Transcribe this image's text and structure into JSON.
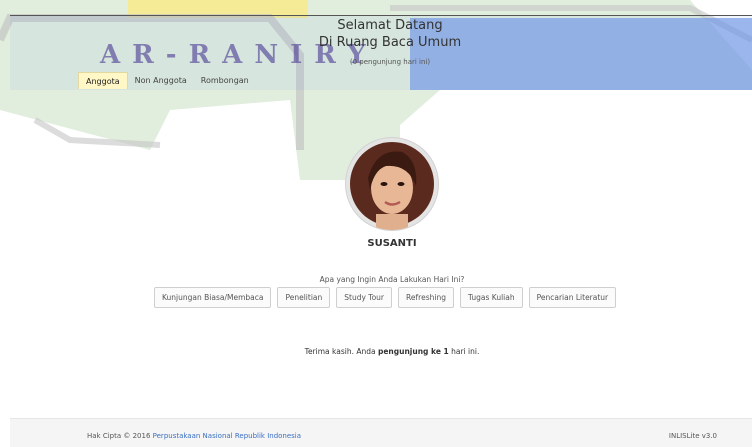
{
  "header": {
    "title": "Selamat Datang",
    "subtitle": "Di Ruang Baca Umum",
    "visitor_count": "(0 pengunjung hari ini)",
    "watermark": "AR-RANIRY"
  },
  "tabs": [
    {
      "label": "Anggota",
      "active": true
    },
    {
      "label": "Non Anggota",
      "active": false
    },
    {
      "label": "Rombongan",
      "active": false
    }
  ],
  "member": {
    "name": "SUSANTI"
  },
  "question": "Apa yang Ingin Anda Lakukan Hari Ini?",
  "actions": [
    "Kunjungan Biasa/Membaca",
    "Penelitian",
    "Study Tour",
    "Refreshing",
    "Tugas Kuliah",
    "Pencarian Literatur"
  ],
  "thanks": {
    "prefix": "Terima kasih. Anda",
    "bold": "pengunjung ke 1",
    "suffix": "hari ini."
  },
  "footer": {
    "copyright_prefix": "Hak Cipta © 2016",
    "copyright_link": "Perpustakaan Nasional Republik Indonesia",
    "version": "INLISLite v3.0"
  },
  "colors": {
    "watermark_green": "#d6ead2",
    "watermark_yellow": "#f7ea8e",
    "header_band_blue": "#6f96e6",
    "link": "#3b6fc4",
    "active_tab": "#fff7c6"
  }
}
